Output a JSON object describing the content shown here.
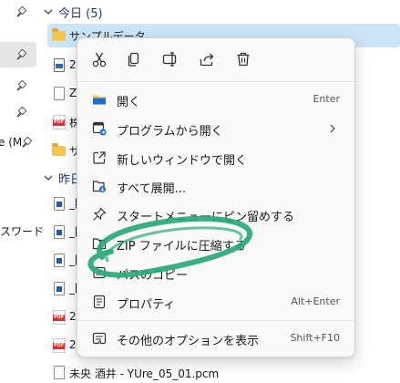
{
  "quick_access": {
    "cut_off_text_1": "e (M",
    "cut_off_text_2": "スワード"
  },
  "groups": [
    {
      "label": "今日 (5)"
    },
    {
      "label": "昨日"
    }
  ],
  "files": {
    "today": [
      {
        "name": "サンプルデータ",
        "icon": "folder-icon"
      },
      {
        "name": "22",
        "icon": "image-icon"
      },
      {
        "name": "Z",
        "icon": "document-icon"
      },
      {
        "name": "株",
        "icon": "pdf-icon"
      },
      {
        "name": "サ",
        "icon": "folder-icon"
      }
    ],
    "yesterday": [
      {
        "name": "_[",
        "icon": "document-icon"
      },
      {
        "name": "_[",
        "icon": "document-icon"
      },
      {
        "name": "_[",
        "icon": "document-icon"
      },
      {
        "name": "_[",
        "icon": "document-icon"
      },
      {
        "name": "20",
        "icon": "pdf-icon"
      },
      {
        "name": "20",
        "icon": "pdf-icon"
      },
      {
        "name": "未央 酒井 - YUre_05_01.pcm",
        "icon": "document-icon"
      }
    ]
  },
  "pdf_badge": "PDF",
  "context_menu": {
    "quick_actions": [
      {
        "name": "cut-icon"
      },
      {
        "name": "copy-icon"
      },
      {
        "name": "rename-icon"
      },
      {
        "name": "share-icon"
      },
      {
        "name": "delete-icon"
      }
    ],
    "items": [
      {
        "label": "開く",
        "shortcut": "Enter",
        "icon": "folder-open-icon"
      },
      {
        "label": "プログラムから開く",
        "shortcut": "",
        "icon": "open-with-icon"
      },
      {
        "label": "新しいウィンドウで開く",
        "shortcut": "",
        "icon": "new-window-icon"
      },
      {
        "label": "すべて展開...",
        "shortcut": "",
        "icon": "extract-icon"
      },
      {
        "label": "スタートメニューにピン留めする",
        "shortcut": "",
        "icon": "pin-icon"
      },
      {
        "label": "ZIP ファイルに圧縮する",
        "shortcut": "",
        "icon": "zip-icon"
      },
      {
        "label": "パスのコピー",
        "shortcut": "",
        "icon": "copy-path-icon"
      },
      {
        "label": "プロパティ",
        "shortcut": "Alt+Enter",
        "icon": "properties-icon"
      },
      {
        "label": "その他のオプションを表示",
        "shortcut": "Shift+F10",
        "icon": "more-options-icon"
      }
    ]
  },
  "colors": {
    "highlight_marker": "#2aa87a",
    "selection": "#cce4f7",
    "group_label": "#1f3f77",
    "folder": "#f5c64d"
  }
}
